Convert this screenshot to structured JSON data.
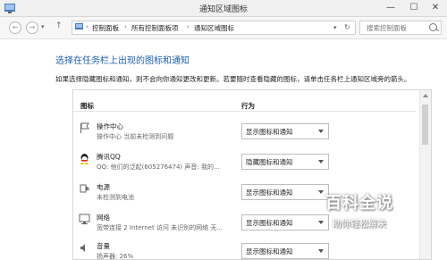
{
  "window": {
    "title": "通知区域图标",
    "minimize": "—",
    "maximize": "☐",
    "close": "✕"
  },
  "nav": {
    "back": "←",
    "forward": "→",
    "up": "↑",
    "breadcrumbs": [
      "控制面板",
      "所有控制面板项",
      "通知区域图标"
    ],
    "separator": "›",
    "search_placeholder": "搜索控制面板"
  },
  "main": {
    "title": "选择在任务栏上出现的图标和通知",
    "description": "如果选择隐藏图标和通知，则不会向你通知更改和更新。若要随时查看隐藏的图标，请单击任务栏上通知区域旁的箭头。",
    "columns": [
      "图标",
      "行为"
    ],
    "rows": [
      {
        "name": "操作中心",
        "sub": "操作中心  当前未检测到问题",
        "behavior": "显示图标和通知",
        "icon": "flag-icon"
      },
      {
        "name": "腾讯QQ",
        "sub": "QQ: 他们的泛起(605276474)  声音:   我的...",
        "behavior": "隐藏图标和通知",
        "icon": "qq-icon"
      },
      {
        "name": "电源",
        "sub": "未检测到电池",
        "behavior": "显示图标和通知",
        "icon": "power-icon"
      },
      {
        "name": "网络",
        "sub": "宽带连接  2 Internet 访问   未识别的网络 无...",
        "behavior": "显示图标和通知",
        "icon": "network-icon"
      },
      {
        "name": "音量",
        "sub": "扬声器: 26%",
        "behavior": "显示图标和通知",
        "icon": "volume-icon"
      }
    ]
  },
  "watermark": {
    "main": "百科全说",
    "sub": "助你轻松解决"
  },
  "colors": {
    "accent_title": "#1e5ea8",
    "qq_red": "#e0251b",
    "qq_yellow": "#f2c21b"
  }
}
